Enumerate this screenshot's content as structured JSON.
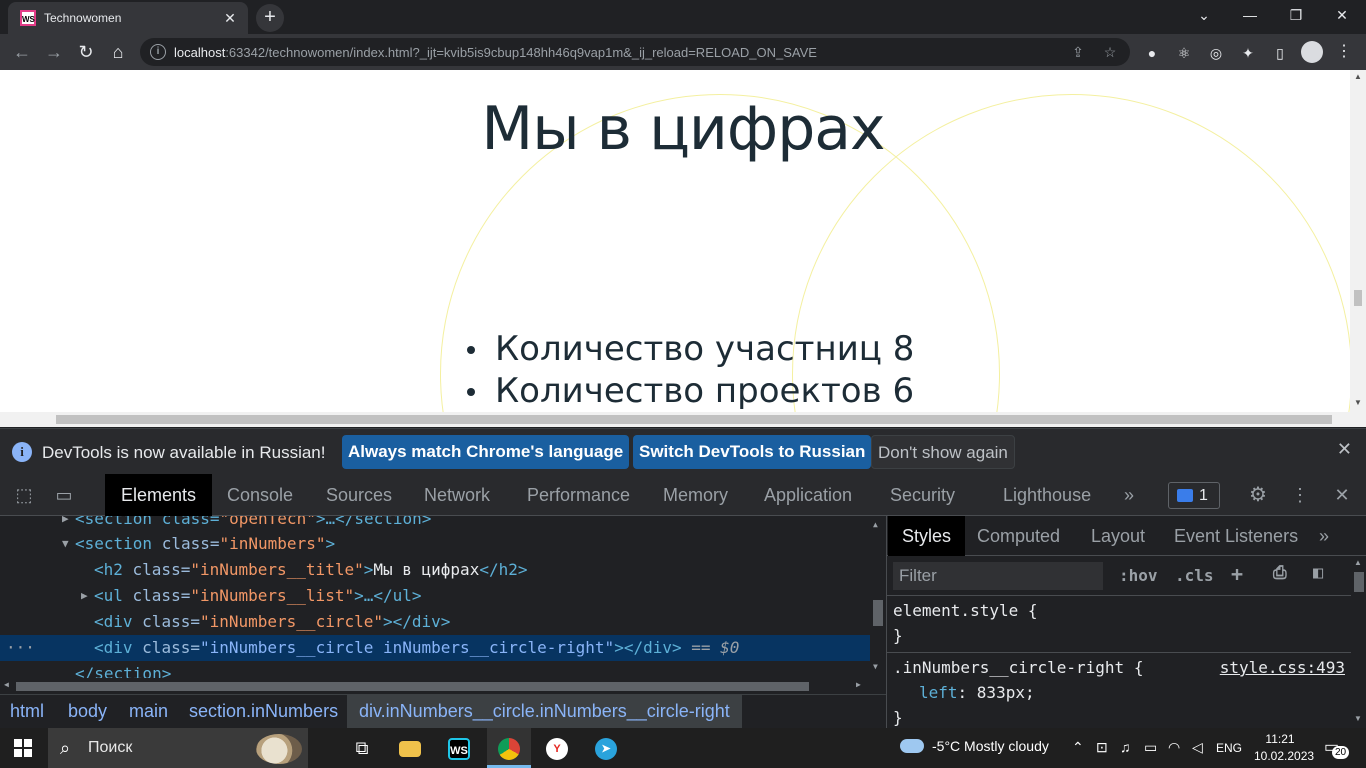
{
  "browser": {
    "tab_title": "Technowomen",
    "tab_favicon_text": "WS",
    "url_host": "localhost",
    "url_rest": ":63342/technowomen/index.html?_ijt=kvib5is9cbup148hh46q9vap1m&_ij_reload=RELOAD_ON_SAVE"
  },
  "page": {
    "title": "Мы в цифрах",
    "stats": [
      "Количество участниц 8",
      "Количество проектов 6"
    ]
  },
  "infobar": {
    "message": "DevTools is now available in Russian!",
    "btn_match": "Always match Chrome's language",
    "btn_switch": "Switch DevTools to Russian",
    "btn_dismiss": "Don't show again"
  },
  "devtools": {
    "tabs": [
      "Elements",
      "Console",
      "Sources",
      "Network",
      "Performance",
      "Memory",
      "Application",
      "Security",
      "Lighthouse"
    ],
    "issues_count": "1",
    "dom": {
      "line0": {
        "open": "<section class=",
        "attr_val": "\"openTech\"",
        "rest": ">…</section>"
      },
      "line1": {
        "tag_open": "<section ",
        "attr": "class=",
        "val": "\"inNumbers\"",
        "close": ">"
      },
      "line2": {
        "tag_open": "<h2 ",
        "attr": "class=",
        "val": "\"inNumbers__title\"",
        "close": ">",
        "text": "Мы в цифрах",
        "end": "</h2>"
      },
      "line3": {
        "tag_open": "<ul ",
        "attr": "class=",
        "val": "\"inNumbers__list\"",
        "close": ">…</ul>"
      },
      "line4": {
        "tag_open": "<div ",
        "attr": "class=",
        "val": "\"inNumbers__circle\"",
        "close": "></div>"
      },
      "line5": {
        "tag_open": "<div ",
        "attr": "class=",
        "val": "\"inNumbers__circle inNumbers__circle-right\"",
        "close": "></div>",
        "eq": "==",
        "dollar": "$0"
      },
      "line6": {
        "text": "</section>"
      }
    },
    "breadcrumbs": [
      "html",
      "body",
      "main",
      "section.inNumbers",
      "div.inNumbers__circle.inNumbers__circle-right"
    ],
    "styles_tabs": [
      "Styles",
      "Computed",
      "Layout",
      "Event Listeners"
    ],
    "filter_placeholder": "Filter",
    "hov": ":hov",
    "cls": ".cls",
    "rules": {
      "element_style": "element.style {",
      "brace_close": "}",
      "selector": ".inNumbers__circle-right {",
      "source": "style.css:493",
      "prop": "left",
      "value": "833px;"
    }
  },
  "taskbar": {
    "search_label": "Поиск",
    "weather": "-5°C  Mostly cloudy",
    "lang": "ENG",
    "time": "11:21",
    "date": "10.02.2023",
    "notifications": "20"
  }
}
